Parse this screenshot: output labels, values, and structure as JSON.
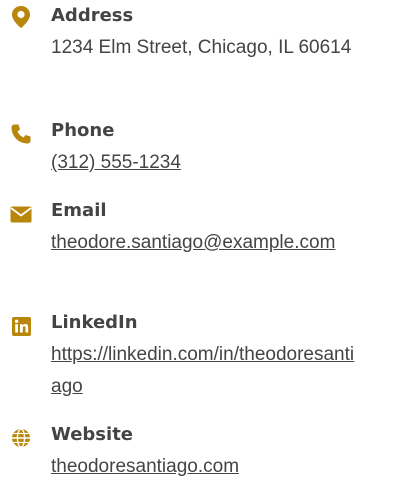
{
  "colors": {
    "accent": "#b8860b",
    "text": "#444444",
    "background": "#ffffff"
  },
  "contact": {
    "address": {
      "icon": "map-pin-icon",
      "label": "Address",
      "value": "1234 Elm Street, Chicago, IL 60614"
    },
    "phone": {
      "icon": "phone-icon",
      "label": "Phone",
      "value": "(312) 555-1234"
    },
    "email": {
      "icon": "envelope-icon",
      "label": "Email",
      "value": "theodore.santiago@example.com"
    },
    "linkedin": {
      "icon": "linkedin-icon",
      "label": "LinkedIn",
      "value": "https://linkedin.com/in/theodoresantiago"
    },
    "website": {
      "icon": "globe-icon",
      "label": "Website",
      "value": "theodoresantiago.com"
    }
  }
}
